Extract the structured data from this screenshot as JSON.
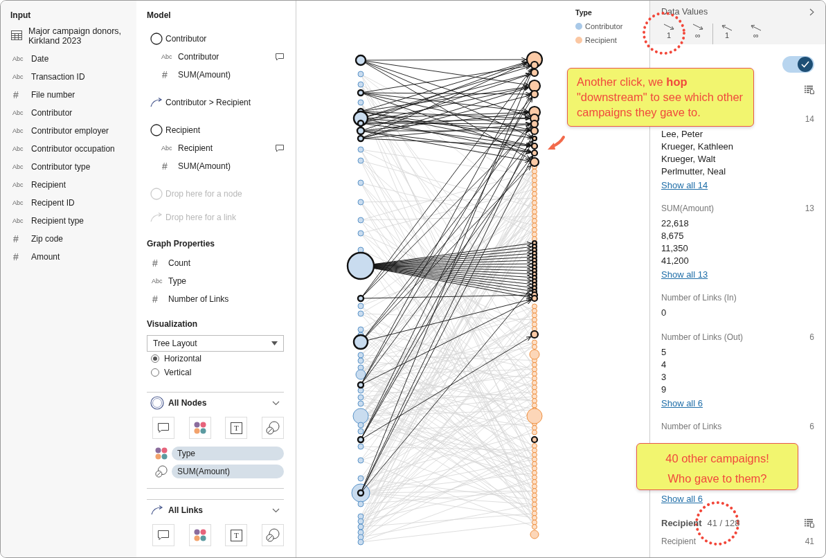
{
  "input": {
    "title": "Input",
    "dataset": "Major campaign donors, Kirkland 2023",
    "fields": [
      {
        "marker": "Abc",
        "name": "Date"
      },
      {
        "marker": "Abc",
        "name": "Transaction ID"
      },
      {
        "marker": "#",
        "name": "File number"
      },
      {
        "marker": "Abc",
        "name": "Contributor"
      },
      {
        "marker": "Abc",
        "name": "Contributor employer"
      },
      {
        "marker": "Abc",
        "name": "Contributor occupation"
      },
      {
        "marker": "Abc",
        "name": "Contributor type"
      },
      {
        "marker": "Abc",
        "name": "Recipient"
      },
      {
        "marker": "Abc",
        "name": "Recipent ID"
      },
      {
        "marker": "Abc",
        "name": "Recipient type"
      },
      {
        "marker": "#",
        "name": "Zip code"
      },
      {
        "marker": "#",
        "name": "Amount"
      }
    ]
  },
  "model": {
    "title": "Model",
    "items": [
      {
        "kind": "node",
        "label": "Contributor",
        "fields": [
          {
            "marker": "Abc",
            "name": "Contributor",
            "tooltip": true
          },
          {
            "marker": "#",
            "name": "SUM(Amount)",
            "tooltip": false
          }
        ]
      },
      {
        "kind": "link",
        "label": "Contributor > Recipient"
      },
      {
        "kind": "node",
        "label": "Recipient",
        "fields": [
          {
            "marker": "Abc",
            "name": "Recipient",
            "tooltip": true
          },
          {
            "marker": "#",
            "name": "SUM(Amount)",
            "tooltip": false
          }
        ]
      },
      {
        "kind": "drop-node",
        "label": "Drop here for a node"
      },
      {
        "kind": "drop-link",
        "label": "Drop here for a link"
      }
    ]
  },
  "graph_properties": {
    "title": "Graph Properties",
    "fields": [
      {
        "marker": "#",
        "name": "Count"
      },
      {
        "marker": "Abc",
        "name": "Type"
      },
      {
        "marker": "#",
        "name": "Number of Links"
      }
    ]
  },
  "visualization": {
    "title": "Visualization",
    "layout": "Tree Layout",
    "orientations": [
      {
        "label": "Horizontal",
        "selected": true
      },
      {
        "label": "Vertical",
        "selected": false
      }
    ]
  },
  "all_nodes": {
    "title": "All Nodes",
    "expanded": true,
    "encoding_buttons": [
      {
        "kind": "tooltip"
      },
      {
        "kind": "color"
      },
      {
        "kind": "label",
        "glyph": "T"
      },
      {
        "kind": "size"
      }
    ],
    "encodings": [
      {
        "kind": "color",
        "label": "Type"
      },
      {
        "kind": "size",
        "label": "SUM(Amount)"
      }
    ]
  },
  "all_links": {
    "title": "All Links",
    "expanded": true,
    "encoding_buttons": [
      {
        "kind": "tooltip"
      },
      {
        "kind": "color"
      },
      {
        "kind": "label",
        "glyph": "T"
      },
      {
        "kind": "size"
      }
    ]
  },
  "legend": {
    "title": "Type",
    "items": [
      {
        "label": "Contributor",
        "color": "#a9c9e8"
      },
      {
        "label": "Recipient",
        "color": "#fbc7a2"
      }
    ]
  },
  "data_values": {
    "title": "Data Values",
    "hop_buttons": [
      {
        "kind": "downstream",
        "label": "1"
      },
      {
        "kind": "downstream",
        "label": "∞"
      },
      {
        "kind": "upstream",
        "label": "1"
      },
      {
        "kind": "upstream",
        "label": "∞"
      }
    ],
    "draw_limit_on": true,
    "groups": [
      {
        "fields": [
          {
            "count": "14",
            "values": [
              "Lee, Peter",
              "Krueger, Kathleen",
              "Krueger, Walt",
              "Perlmutter, Neal"
            ],
            "show_all": "Show all 14"
          },
          {
            "name": "SUM(Amount)",
            "count": "13",
            "values": [
              "22,618",
              "8,675",
              "11,350",
              "41,200"
            ],
            "show_all": "Show all 13"
          },
          {
            "name": "Number of Links (In)",
            "values": [
              "0"
            ]
          },
          {
            "name": "Number of Links (Out)",
            "count": "6",
            "values": [
              "5",
              "4",
              "3",
              "9"
            ],
            "show_all": "Show all 6"
          },
          {
            "name": "Number of Links",
            "count": "6",
            "show_all": "Show all 6"
          }
        ]
      },
      {
        "title": "Recipient",
        "count": "41 / 128",
        "fields": [
          {
            "name": "Recipient",
            "count": "41"
          }
        ]
      }
    ]
  },
  "callouts": [
    {
      "text": "Another click, we **hop** \"downstream\" to see which other campaigns they gave to."
    },
    {
      "lines": [
        "40 other campaigns!",
        "Who gave to them?"
      ]
    }
  ]
}
